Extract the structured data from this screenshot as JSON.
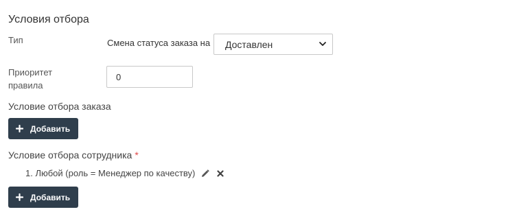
{
  "section_title": "Условия отбора",
  "type_field": {
    "label": "Тип",
    "inline_text": "Смена статуса заказа на",
    "selected_value": "Доставлен"
  },
  "priority_field": {
    "label": "Приоритет правила",
    "value": "0"
  },
  "order_condition": {
    "title": "Условие отбора заказа",
    "add_label": "Добавить"
  },
  "employee_condition": {
    "title": "Условие отбора сотрудника",
    "required_mark": "*",
    "items": [
      {
        "text": "1. Любой (роль = Менеджер по качеству)"
      }
    ],
    "add_label": "Добавить"
  },
  "icons": {
    "select_chevron": "chevron-down-icon",
    "add": "plus-icon",
    "edit": "pencil-icon",
    "remove": "close-icon"
  },
  "colors": {
    "button_bg": "#2f3e4c",
    "required": "#e04a4a"
  }
}
